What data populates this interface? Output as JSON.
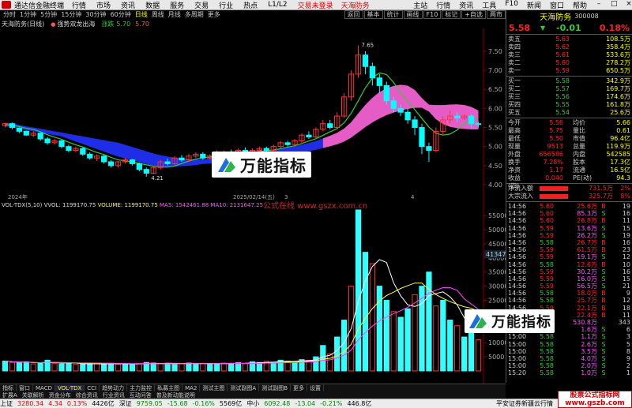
{
  "menubar": {
    "title": "通达信金融终端",
    "items": [
      "行情",
      "市场",
      "资讯",
      "数据",
      "服务",
      "交易",
      "行业",
      "热点",
      "L1/L2"
    ],
    "red_items": [
      "交易未登录",
      "天海防务"
    ],
    "right_items": [
      "主站",
      "行情",
      "资讯",
      "工具",
      "F10",
      "新闻",
      "窗口",
      "帮助"
    ]
  },
  "toolbar": {
    "periods": [
      "分时",
      "1分钟",
      "5分钟",
      "15分钟",
      "30分钟",
      "60分钟",
      "日线",
      "周线",
      "月线",
      "多周期",
      "更多"
    ],
    "selected": "日线",
    "right": [
      "返回",
      "基本",
      "统计",
      "画线",
      "F10",
      "标记",
      "+自选",
      "两市"
    ]
  },
  "stock": {
    "name": "天海防务(日线)",
    "indicator": "强势双龙出海",
    "pct_label": "涨跌",
    "v1": "5.70",
    "v2": "5.70"
  },
  "chart_data": [
    {
      "type": "candlestick",
      "title": "天海防务(日线)",
      "ylim": [
        4.0,
        7.85
      ],
      "yticks": [
        "7.50",
        "7.00",
        "6.50",
        "6.00",
        "5.50",
        "5.00",
        "4.50",
        "4.00"
      ],
      "high_label": "7.65",
      "low_label": "4.21",
      "xlabels": [
        "2024年",
        "2025/02/14(五)",
        "3",
        "4"
      ],
      "candles": [
        [
          5.55,
          5.6,
          5.62,
          5.5
        ],
        [
          5.6,
          5.5,
          5.63,
          5.45
        ],
        [
          5.48,
          5.4,
          5.5,
          5.35
        ],
        [
          5.4,
          5.3,
          5.42,
          5.28
        ],
        [
          5.3,
          5.35,
          5.4,
          5.25
        ],
        [
          5.35,
          5.2,
          5.38,
          5.15
        ],
        [
          5.2,
          5.1,
          5.25,
          5.05
        ],
        [
          5.1,
          5.15,
          5.2,
          5.05
        ],
        [
          5.15,
          5.0,
          5.18,
          4.95
        ],
        [
          5.0,
          4.9,
          5.05,
          4.85
        ],
        [
          4.9,
          4.95,
          5.0,
          4.85
        ],
        [
          4.95,
          4.8,
          4.98,
          4.75
        ],
        [
          4.8,
          4.7,
          4.85,
          4.65
        ],
        [
          4.7,
          4.75,
          4.8,
          4.62
        ],
        [
          4.75,
          4.6,
          4.78,
          4.55
        ],
        [
          4.6,
          4.5,
          4.65,
          4.45
        ],
        [
          4.5,
          4.6,
          4.62,
          4.45
        ],
        [
          4.6,
          4.65,
          4.7,
          4.55
        ],
        [
          4.65,
          4.55,
          4.68,
          4.5
        ],
        [
          4.55,
          4.4,
          4.58,
          4.35
        ],
        [
          4.4,
          4.3,
          4.45,
          4.21
        ],
        [
          4.3,
          4.45,
          4.5,
          4.28
        ],
        [
          4.45,
          4.6,
          4.65,
          4.4
        ],
        [
          4.6,
          4.55,
          4.68,
          4.5
        ],
        [
          4.55,
          4.7,
          4.75,
          4.5
        ],
        [
          4.7,
          4.65,
          4.78,
          4.6
        ],
        [
          4.65,
          4.75,
          4.8,
          4.6
        ],
        [
          4.75,
          4.8,
          4.85,
          4.7
        ],
        [
          4.8,
          4.7,
          4.85,
          4.65
        ],
        [
          4.7,
          4.75,
          4.8,
          4.66
        ],
        [
          4.75,
          4.8,
          4.9,
          4.72
        ],
        [
          4.8,
          4.85,
          4.9,
          4.75
        ],
        [
          4.85,
          4.8,
          4.92,
          4.75
        ],
        [
          4.8,
          4.9,
          4.95,
          4.78
        ],
        [
          4.9,
          4.85,
          4.98,
          4.8
        ],
        [
          4.85,
          4.9,
          4.95,
          4.8
        ],
        [
          4.9,
          4.95,
          5.0,
          4.85
        ],
        [
          4.95,
          4.9,
          5.0,
          4.85
        ],
        [
          4.9,
          5.0,
          5.05,
          4.88
        ],
        [
          5.0,
          5.1,
          5.15,
          4.95
        ],
        [
          5.1,
          5.05,
          5.15,
          5.0
        ],
        [
          5.05,
          5.15,
          5.2,
          5.0
        ],
        [
          5.15,
          5.3,
          5.35,
          5.1
        ],
        [
          5.3,
          5.25,
          5.4,
          5.2
        ],
        [
          5.25,
          5.45,
          5.5,
          5.2
        ],
        [
          5.45,
          5.6,
          5.7,
          5.4
        ],
        [
          5.6,
          5.5,
          5.7,
          5.45
        ],
        [
          5.5,
          5.8,
          5.9,
          5.45
        ],
        [
          5.8,
          6.3,
          6.4,
          5.75
        ],
        [
          6.3,
          6.9,
          7.0,
          6.2
        ],
        [
          6.9,
          7.4,
          7.65,
          6.8
        ],
        [
          7.4,
          7.1,
          7.5,
          6.9
        ],
        [
          7.1,
          6.8,
          7.2,
          6.6
        ],
        [
          6.8,
          6.6,
          6.9,
          6.4
        ],
        [
          6.6,
          6.2,
          6.7,
          6.1
        ],
        [
          6.2,
          6.0,
          6.3,
          5.9
        ],
        [
          6.0,
          5.9,
          6.1,
          5.8
        ],
        [
          5.9,
          5.7,
          6.0,
          5.6
        ],
        [
          5.7,
          5.5,
          5.8,
          5.3
        ],
        [
          5.5,
          5.0,
          5.6,
          4.8
        ],
        [
          5.0,
          4.9,
          5.1,
          4.6
        ],
        [
          4.9,
          5.4,
          5.5,
          4.85
        ],
        [
          5.4,
          5.7,
          5.8,
          5.3
        ],
        [
          5.7,
          5.8,
          5.95,
          5.6
        ],
        [
          5.8,
          5.75,
          5.9,
          5.65
        ],
        [
          5.75,
          5.8,
          5.85,
          5.7
        ],
        [
          5.8,
          5.6,
          5.85,
          5.5
        ],
        [
          5.6,
          5.58,
          5.65,
          5.5
        ]
      ]
    },
    {
      "type": "bar",
      "title": "VOL-TDX(5,10)",
      "legend": [
        "VVOL: 1199170.75",
        "VOLUME: 1199170.75",
        "MA5: 1542461.88",
        "MA10: 2131647.25"
      ],
      "yticks": [
        "55000",
        "50000",
        "45000",
        "40000",
        "35000",
        "30000",
        "25000",
        "20000",
        "15000",
        "10000",
        "5000"
      ],
      "marker": "41347",
      "ymax": 57000,
      "values": [
        3500,
        3000,
        2800,
        3200,
        2500,
        2600,
        3800,
        2700,
        2500,
        2600,
        2300,
        2400,
        2800,
        2500,
        2300,
        2700,
        2400,
        2600,
        2200,
        2600,
        3000,
        2800,
        2500,
        2700,
        2400,
        2600,
        2800,
        2500,
        2700,
        2400,
        2600,
        2800,
        2700,
        2900,
        2600,
        3200,
        3000,
        3400,
        3100,
        3800,
        3500,
        3200,
        4000,
        3800,
        5000,
        9000,
        6000,
        12000,
        18000,
        30000,
        57000,
        42000,
        38000,
        30000,
        25000,
        21000,
        19000,
        22000,
        27000,
        30000,
        35000,
        23000,
        25000,
        18000,
        16000,
        12000,
        14000,
        11000
      ]
    }
  ],
  "rpanel": {
    "name": "天海防务",
    "code": "300008",
    "price": "5.58",
    "change": "-0.01",
    "pct": "0.18%",
    "sells": [
      [
        "卖五",
        "5.63",
        "108.5万"
      ],
      [
        "卖四",
        "5.62",
        "358.4万"
      ],
      [
        "卖三",
        "5.61",
        "533.6万"
      ],
      [
        "卖二",
        "5.60",
        "278.2万"
      ],
      [
        "卖一",
        "5.59",
        "650.5万"
      ]
    ],
    "buys": [
      [
        "买一",
        "5.58",
        "342.9万"
      ],
      [
        "买二",
        "5.57",
        "169.7万"
      ],
      [
        "买三",
        "5.56",
        "174.6万"
      ],
      [
        "买四",
        "5.55",
        "161.8万"
      ],
      [
        "买五",
        "5.54",
        "25.6万"
      ]
    ],
    "stats": [
      [
        "今开",
        "5.56",
        "均价",
        "5.66"
      ],
      [
        "最高",
        "5.75",
        "量比",
        "0.61"
      ],
      [
        "最低",
        "5.50",
        "市值",
        "96.4亿"
      ],
      [
        "现量",
        "9513",
        "总量",
        "119.9万"
      ],
      [
        "外盘",
        "656586",
        "内盘",
        "542585"
      ],
      [
        "换手",
        "7.28%",
        "股本",
        "17.3亿"
      ],
      [
        "净资",
        "1.17",
        "流通",
        "16.5亿"
      ],
      [
        "收益(四)",
        "0.040",
        "PE(动)",
        "94.3"
      ]
    ],
    "flows": [
      [
        "净流入额",
        "731.5万",
        "2%"
      ],
      [
        "大宗流入",
        "325.7万",
        "8%"
      ]
    ],
    "ticks": [
      [
        "14:56",
        "5.60",
        "25.6万",
        "B",
        "19"
      ],
      [
        "14:56",
        "5.60",
        "85.3万",
        "S",
        "16"
      ],
      [
        "14:56",
        "5.60",
        "26.8万",
        "B",
        "11"
      ],
      [
        "14:56",
        "5.59",
        "13.6万",
        "S",
        "15"
      ],
      [
        "14:56",
        "5.59",
        "26.2万",
        "S",
        "19"
      ],
      [
        "14:56",
        "5.58",
        "26.7万",
        "B",
        "16"
      ],
      [
        "14:56",
        "5.59",
        "61.5万",
        "B",
        "23"
      ],
      [
        "14:56",
        "5.59",
        "19.1万",
        "S",
        "12"
      ],
      [
        "14:56",
        "5.58",
        "12.6万",
        "B",
        "10"
      ],
      [
        "14:56",
        "5.59",
        "30.2万",
        "S",
        "16"
      ],
      [
        "14:56",
        "5.59",
        "16.0万",
        "S",
        "15"
      ],
      [
        "14:56",
        "5.59",
        "56.5万",
        "S",
        "21"
      ],
      [
        "14:56",
        "5.58",
        "18.0万",
        "B",
        "9"
      ],
      [
        "14:56",
        "5.58",
        "25.7万",
        "B",
        "12"
      ],
      [
        "14:56",
        "5.59",
        "22.1万",
        "B",
        "18"
      ],
      [
        "14:56",
        "5.59",
        "22.4万",
        "B",
        "11"
      ],
      [
        "15:00",
        "5.58",
        "530.8万",
        "",
        "343"
      ],
      [
        "15:00",
        "5.58",
        "1.6万",
        "S",
        "6"
      ],
      [
        "15:00",
        "5.58",
        "1.1万",
        "S",
        "3"
      ],
      [
        "15:00",
        "5.58",
        "2.6万",
        "S",
        "5"
      ],
      [
        "15:00",
        "5.58",
        "3.5万",
        "S",
        "8"
      ],
      [
        "15:00",
        "5.58",
        "4.0万",
        "S",
        "9"
      ],
      [
        "15:00",
        "5.58",
        "2.0万",
        "S",
        "2"
      ],
      [
        "15:20",
        "5.58",
        "1.0万",
        "S",
        "1"
      ]
    ]
  },
  "tabs1": [
    "指标",
    "窗口",
    "MACD",
    "VOL-TDX",
    "CCI",
    "趋势动力",
    "主力监控",
    "私募主图",
    "MA2",
    "测试主图",
    "测试副图A",
    "测试副图B",
    "更多",
    "设置"
  ],
  "tabs2": [
    "扩展A",
    "关联解析",
    "资金分布",
    "综合资讯",
    "行业资讯",
    "互动问答",
    "普及新动能说明"
  ],
  "statusbar": [
    [
      "上证",
      "3280.34",
      "4.34",
      "0.13%",
      "4426亿"
    ],
    [
      "深证",
      "9759.05",
      "-15.68",
      "-0.16%",
      "5569亿"
    ],
    [
      "中小",
      "6092.48",
      "-13.04",
      "-0.21%",
      "446.8亿"
    ]
  ],
  "status_right": "平安证券新疆云行情",
  "watermark": {
    "text": "万能指标",
    "url": "公式在线 www.gszx.com.cn",
    "site": "股票公式指标网 www.gszb.com"
  },
  "colors": {
    "up": "#ff3333",
    "down": "#33ff33",
    "bg": "#000000",
    "ma_blue": "#2233ff",
    "ma_pink": "#ff66dd"
  }
}
